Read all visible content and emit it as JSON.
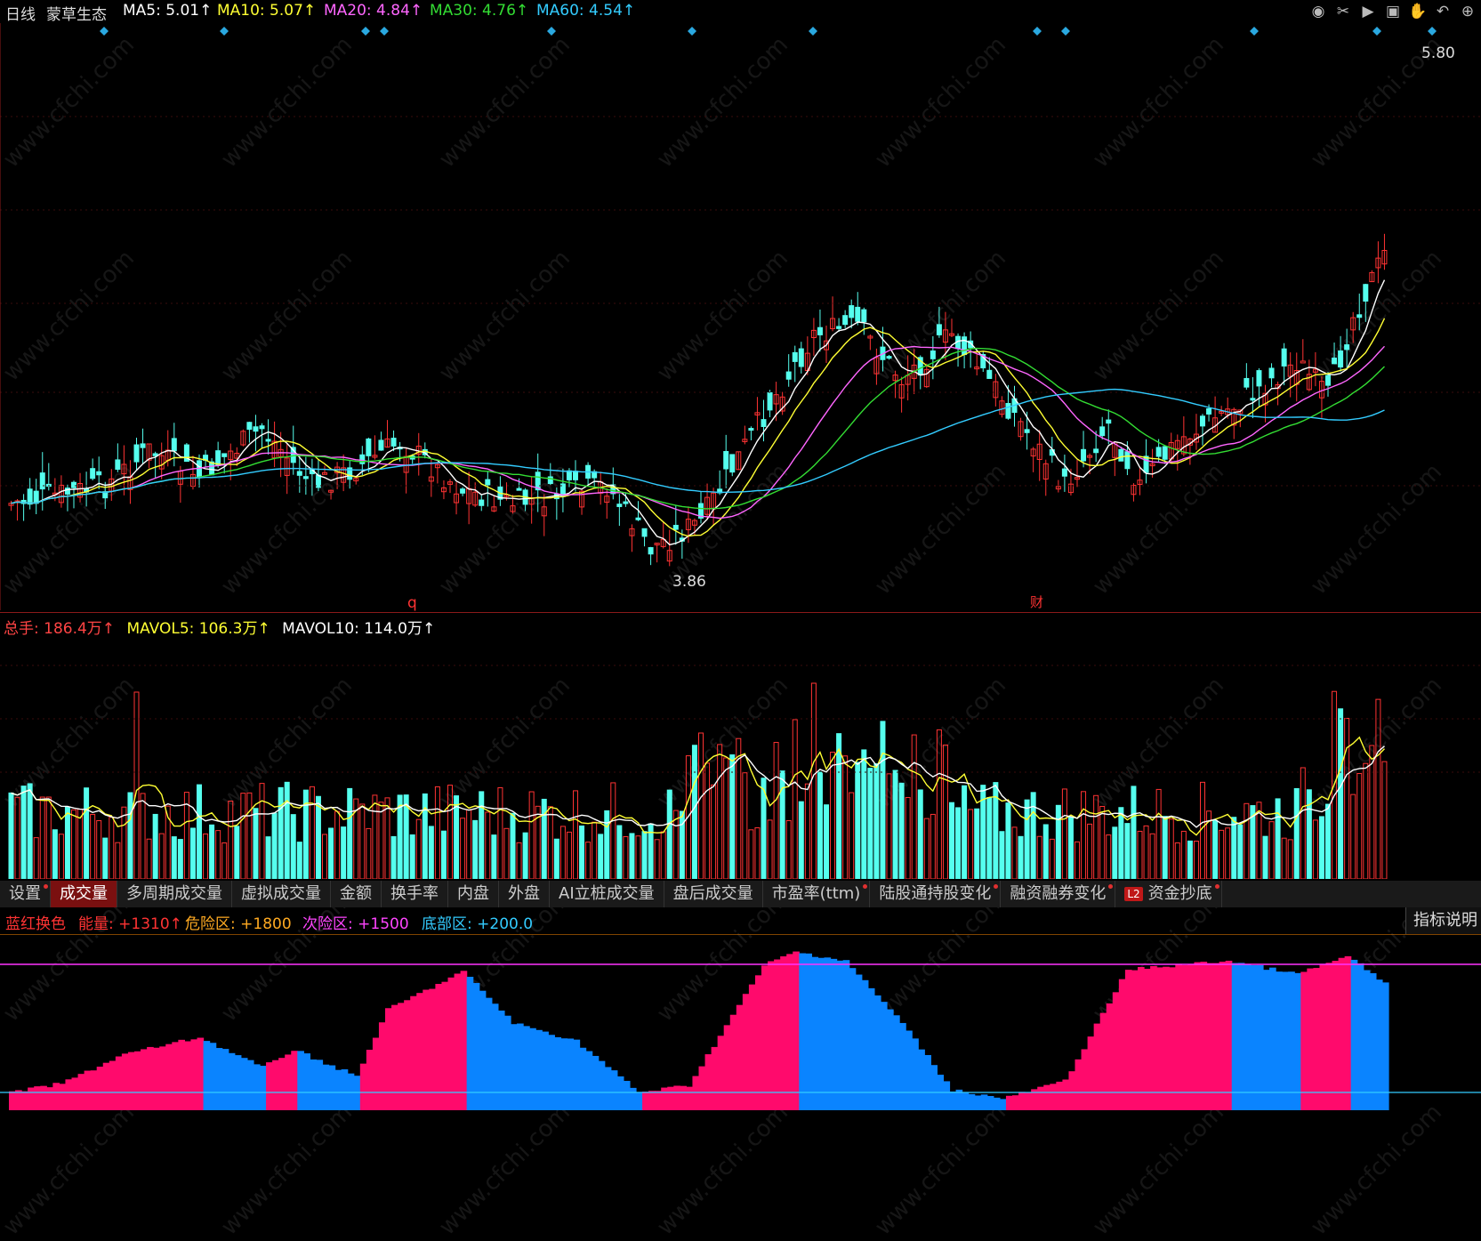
{
  "header": {
    "period": "日线",
    "stock_name": "蒙草生态",
    "ma": [
      {
        "label": "MA5: 5.01↑",
        "color": "#ffffff"
      },
      {
        "label": "MA10: 5.07↑",
        "color": "#ffff33"
      },
      {
        "label": "MA20: 4.84↑",
        "color": "#ff66ff"
      },
      {
        "label": "MA30: 4.76↑",
        "color": "#33dd33"
      },
      {
        "label": "MA60: 4.54↑",
        "color": "#33ccff"
      }
    ]
  },
  "toolbar": {
    "icons": [
      "eye-icon",
      "scissors-icon",
      "play-icon",
      "lock-icon",
      "hand-icon",
      "undo-icon",
      "zoom-in-icon"
    ]
  },
  "price_chart": {
    "high_label": "5.80",
    "low_label": "3.86",
    "event_marker_q": "q",
    "event_marker_cai": "财"
  },
  "volume_panel": {
    "total_label": "总手: 186.4万↑",
    "mavol5_label": "MAVOL5: 106.3万↑",
    "mavol10_label": "MAVOL10: 114.0万↑"
  },
  "tabs": [
    {
      "label": "设置",
      "dot": true
    },
    {
      "label": "成交量",
      "active": true
    },
    {
      "label": "多周期成交量"
    },
    {
      "label": "虚拟成交量"
    },
    {
      "label": "金额"
    },
    {
      "label": "换手率"
    },
    {
      "label": "内盘"
    },
    {
      "label": "外盘"
    },
    {
      "label": "AI立桩成交量"
    },
    {
      "label": "盘后成交量"
    },
    {
      "label": "市盈率(ttm)",
      "dot": true
    },
    {
      "label": "陆股通持股变化",
      "dot": true
    },
    {
      "label": "融资融券变化",
      "dot": true
    },
    {
      "label": "资金抄底",
      "l2": "L2",
      "dot": true
    }
  ],
  "indicator": {
    "name": "蓝红换色",
    "energy": "能量: +1310↑",
    "danger": "危险区: +1800",
    "sub_danger": "次险区: +1500",
    "bottom": "底部区: +200.0",
    "explain_button": "指标说明"
  },
  "colors": {
    "up": "#ff3333",
    "down": "#55ffee",
    "indicator_red": "#ff0a6c",
    "indicator_blue": "#0a84ff"
  },
  "watermark": "www.cfchi.com"
}
